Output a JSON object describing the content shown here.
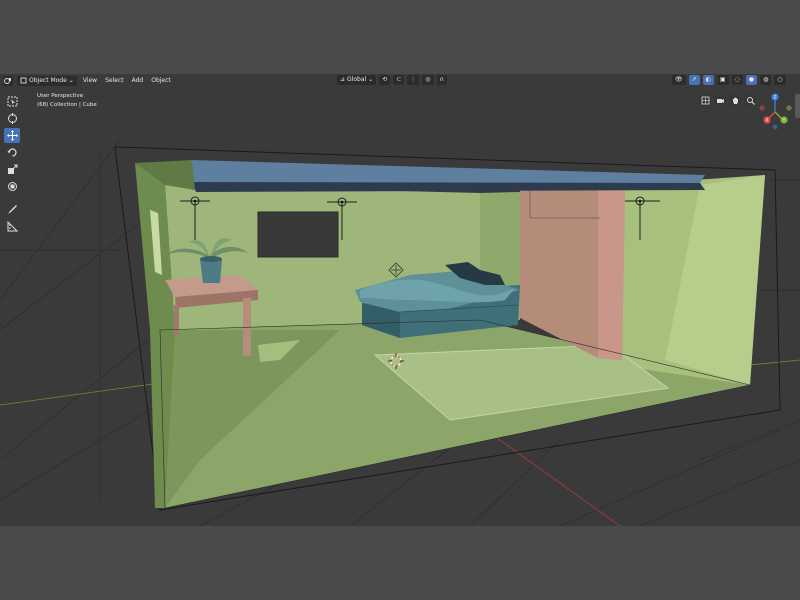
{
  "header": {
    "mode_label": "Object Mode",
    "menus": [
      "View",
      "Select",
      "Add",
      "Object"
    ],
    "orientation_label": "Global"
  },
  "viewport": {
    "perspective_label": "User Perspective",
    "collection_label": "(68) Collection | Cube"
  },
  "gizmo": {
    "z_label": "Z",
    "y_label": "Y",
    "x_label": "X"
  },
  "colors": {
    "accent": "#4772b3",
    "x_axis": "#e04848",
    "y_axis": "#7ab33c",
    "z_axis": "#3d7fe0"
  },
  "icons": {
    "toolbar": [
      "select-box-icon",
      "cursor-icon",
      "move-icon",
      "rotate-icon",
      "scale-icon",
      "transform-icon",
      "annotate-icon",
      "measure-icon"
    ],
    "nav": [
      "camera-grid-icon",
      "camera-icon",
      "hand-icon",
      "zoom-icon"
    ]
  }
}
